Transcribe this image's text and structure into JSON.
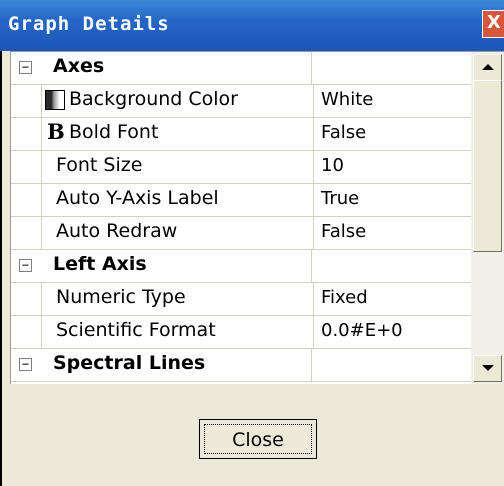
{
  "window": {
    "title": "Graph Details",
    "close_glyph": "X"
  },
  "grid": {
    "rows": [
      {
        "kind": "category",
        "toggle": "−",
        "label": "Axes",
        "value": ""
      },
      {
        "kind": "property",
        "icon": "background-color-icon",
        "label": "Background Color",
        "value": "White"
      },
      {
        "kind": "property",
        "icon": "bold-font-icon",
        "icon_text": "B",
        "label": "Bold Font",
        "value": "False"
      },
      {
        "kind": "property",
        "label": "Font Size",
        "value": "10"
      },
      {
        "kind": "property",
        "label": "Auto Y-Axis Label",
        "value": "True"
      },
      {
        "kind": "property",
        "label": "Auto Redraw",
        "value": "False"
      },
      {
        "kind": "category",
        "toggle": "−",
        "label": "Left Axis",
        "value": ""
      },
      {
        "kind": "property",
        "label": "Numeric Type",
        "value": "Fixed"
      },
      {
        "kind": "property",
        "label": "Scientific Format",
        "value": "0.0#E+0"
      },
      {
        "kind": "category",
        "toggle": "−",
        "label": "Spectral Lines",
        "value": ""
      }
    ]
  },
  "buttons": {
    "close_label": "Close"
  },
  "colors": {
    "title_bar": "#2566c5",
    "dialog_bg": "#ece9d8",
    "grid_line": "#d4d0c8"
  }
}
